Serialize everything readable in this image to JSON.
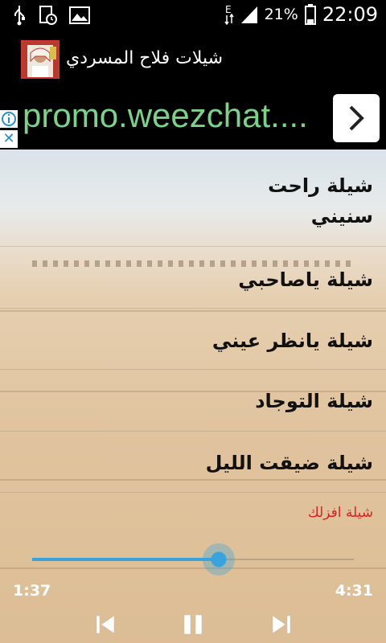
{
  "status_bar": {
    "battery_percent": "21%",
    "time": "22:09",
    "icons": [
      "usb-icon",
      "clock-file-icon",
      "image-icon",
      "data-arrows-icon",
      "signal-icon",
      "battery-icon"
    ]
  },
  "app_bar": {
    "title": "شيلات فلاح المسردي"
  },
  "ad_banner": {
    "text": "promo.weezchat...."
  },
  "tracks": [
    "شيلة راحت سنيني",
    "شيلة ياصاحبي",
    "شيلة يانظر عيني",
    "شيلة التوجاد",
    "شيلة ضيقت الليل"
  ],
  "now_playing": "شيلة افزلك",
  "player": {
    "current_time": "1:37",
    "total_time": "4:31",
    "progress": 0.58,
    "accent": "#39a3dd"
  },
  "colors": {
    "now_playing_text": "#e02020",
    "ad_text": "#7bd38a"
  }
}
